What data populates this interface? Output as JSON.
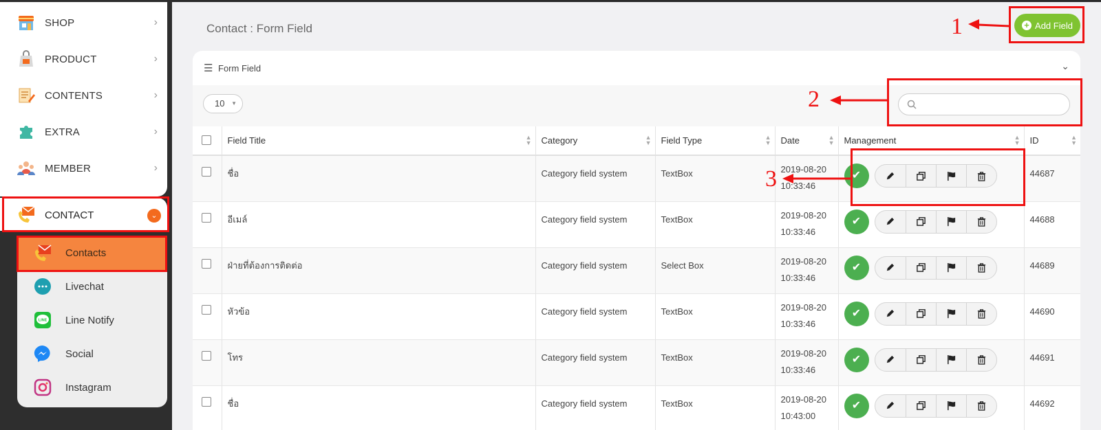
{
  "sidebar": {
    "menu": [
      {
        "label": "SHOP",
        "icon": "shop-icon"
      },
      {
        "label": "PRODUCT",
        "icon": "product-icon"
      },
      {
        "label": "CONTENTS",
        "icon": "contents-icon"
      },
      {
        "label": "EXTRA",
        "icon": "puzzle-icon"
      },
      {
        "label": "MEMBER",
        "icon": "member-icon"
      }
    ],
    "contact": {
      "label": "CONTACT",
      "icon": "contact-icon"
    },
    "submenu": [
      {
        "label": "Contacts",
        "icon": "contacts-icon"
      },
      {
        "label": "Livechat",
        "icon": "livechat-icon"
      },
      {
        "label": "Line Notify",
        "icon": "line-icon"
      },
      {
        "label": "Social",
        "icon": "messenger-icon"
      },
      {
        "label": "Instagram",
        "icon": "instagram-icon"
      }
    ]
  },
  "page": {
    "title": "Contact : Form Field",
    "add_button": "Add Field"
  },
  "card": {
    "title": "Form Field",
    "page_size": "10",
    "search_placeholder": ""
  },
  "table": {
    "headers": [
      "Field Title",
      "Category",
      "Field Type",
      "Date",
      "Management",
      "ID"
    ],
    "rows": [
      {
        "title": "ชื่อ",
        "category": "Category field system",
        "type": "TextBox",
        "date": "2019-08-20",
        "time": "10:33:46",
        "id": "44687"
      },
      {
        "title": "อีเมล์",
        "category": "Category field system",
        "type": "TextBox",
        "date": "2019-08-20",
        "time": "10:33:46",
        "id": "44688"
      },
      {
        "title": "ฝ่ายที่ต้องการติดต่อ",
        "category": "Category field system",
        "type": "Select Box",
        "date": "2019-08-20",
        "time": "10:33:46",
        "id": "44689"
      },
      {
        "title": "หัวข้อ",
        "category": "Category field system",
        "type": "TextBox",
        "date": "2019-08-20",
        "time": "10:33:46",
        "id": "44690"
      },
      {
        "title": "โทร",
        "category": "Category field system",
        "type": "TextBox",
        "date": "2019-08-20",
        "time": "10:33:46",
        "id": "44691"
      },
      {
        "title": "ชื่อ",
        "category": "Category field system",
        "type": "TextBox",
        "date": "2019-08-20",
        "time": "10:43:00",
        "id": "44692"
      }
    ]
  },
  "annotations": [
    "1",
    "2",
    "3"
  ],
  "colors": {
    "annotation": "#ee1111",
    "add_button": "#7fc331",
    "active_submenu": "#f5853f",
    "approve": "#4caf50",
    "sidebar_dark": "#2e2e2e"
  }
}
